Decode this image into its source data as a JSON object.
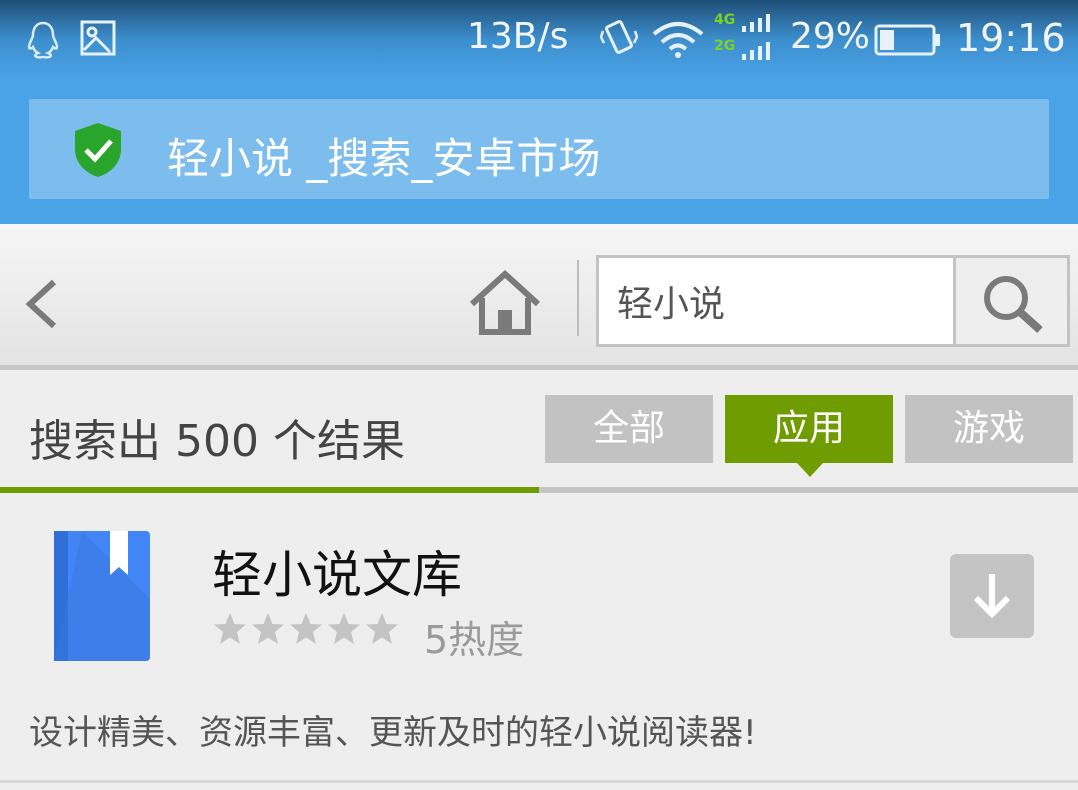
{
  "status_bar": {
    "net_speed": "13B/s",
    "network_4g": "4G",
    "network_2g": "2G",
    "battery_percent": "29%",
    "battery_level": 0.29,
    "time": "19:16",
    "icons": [
      "qq-icon",
      "gallery-icon",
      "vibrate-icon",
      "wifi-icon",
      "signal-icon",
      "battery-icon"
    ]
  },
  "header": {
    "page_title": "轻小说 _搜索_安卓市场",
    "secure_icon": "shield-check-icon",
    "accent_color": "#4aa3e6"
  },
  "toolbar": {
    "back_icon": "chevron-left-icon",
    "home_icon": "home-icon",
    "search_value": "轻小说",
    "search_icon": "search-icon"
  },
  "results": {
    "count_text": "搜索出 500 个结果",
    "tabs": [
      {
        "label": "全部",
        "active": false
      },
      {
        "label": "应用",
        "active": true
      },
      {
        "label": "游戏",
        "active": false
      }
    ],
    "active_color": "#6f9c00",
    "progress_fraction": 0.5
  },
  "app": {
    "name": "轻小说文库",
    "rating_stars": 0,
    "rating_max": 5,
    "heat_text": "5热度",
    "description": "设计精美、资源丰富、更新及时的轻小说阅读器!",
    "download_icon": "download-icon"
  }
}
